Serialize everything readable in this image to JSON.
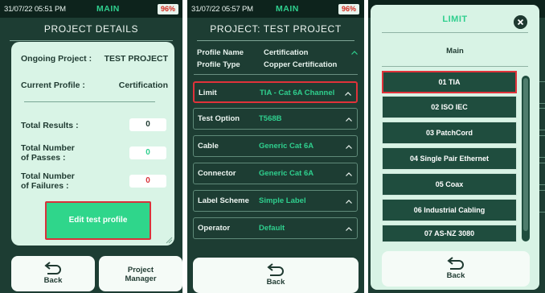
{
  "colors": {
    "dark_green": "#1d3d33",
    "accent_green": "#2fcf8e",
    "light_card": "#d9f4e6",
    "highlight_red": "#d8323a",
    "battery_red": "#d42a1e"
  },
  "screen1": {
    "status": {
      "time": "31/07/22 05:51 PM",
      "mode": "MAIN",
      "battery": "96%"
    },
    "title": "PROJECT DETAILS",
    "ongoing_project_label": "Ongoing Project :",
    "ongoing_project_value": "TEST PROJECT",
    "current_profile_label": "Current Profile :",
    "current_profile_value": "Certification",
    "total_results_label": "Total Results :",
    "total_results_value": "0",
    "total_passes_label_1": "Total Number",
    "total_passes_label_2": "of Passes :",
    "total_passes_value": "0",
    "total_failures_label_1": "Total Number",
    "total_failures_label_2": "of Failures :",
    "total_failures_value": "0",
    "edit_button": "Edit test profile",
    "back_button": "Back",
    "project_manager_1": "Project",
    "project_manager_2": "Manager",
    "icons": {
      "back": "back-arrow-icon"
    }
  },
  "screen2": {
    "status": {
      "time": "31/07/22 05:57 PM",
      "mode": "MAIN",
      "battery": "96%"
    },
    "title": "PROJECT: TEST PROJECT",
    "profile_name_label": "Profile Name",
    "profile_name_value": "Certification",
    "profile_type_label": "Profile Type",
    "profile_type_value": "Copper Certification",
    "settings": [
      {
        "label": "Limit",
        "value": "TIA - Cat 6A Channel"
      },
      {
        "label": "Test Option",
        "value": "T568B"
      },
      {
        "label": "Cable",
        "value": "Generic Cat 6A"
      },
      {
        "label": "Connector",
        "value": "Generic Cat 6A"
      },
      {
        "label": "Label Scheme",
        "value": "Simple Label"
      },
      {
        "label": "Operator",
        "value": "Default"
      }
    ],
    "back_button": "Back"
  },
  "screen3": {
    "modal_title": "LIMIT",
    "modal_subtitle": "Main",
    "items": [
      "01 TIA",
      "02 ISO IEC",
      "03 PatchCord",
      "04 Single Pair Ethernet",
      "05 Coax",
      "06 Industrial Cabling",
      "07 AS-NZ 3080"
    ],
    "back_button": "Back",
    "icons": {
      "close": "close-icon"
    }
  }
}
